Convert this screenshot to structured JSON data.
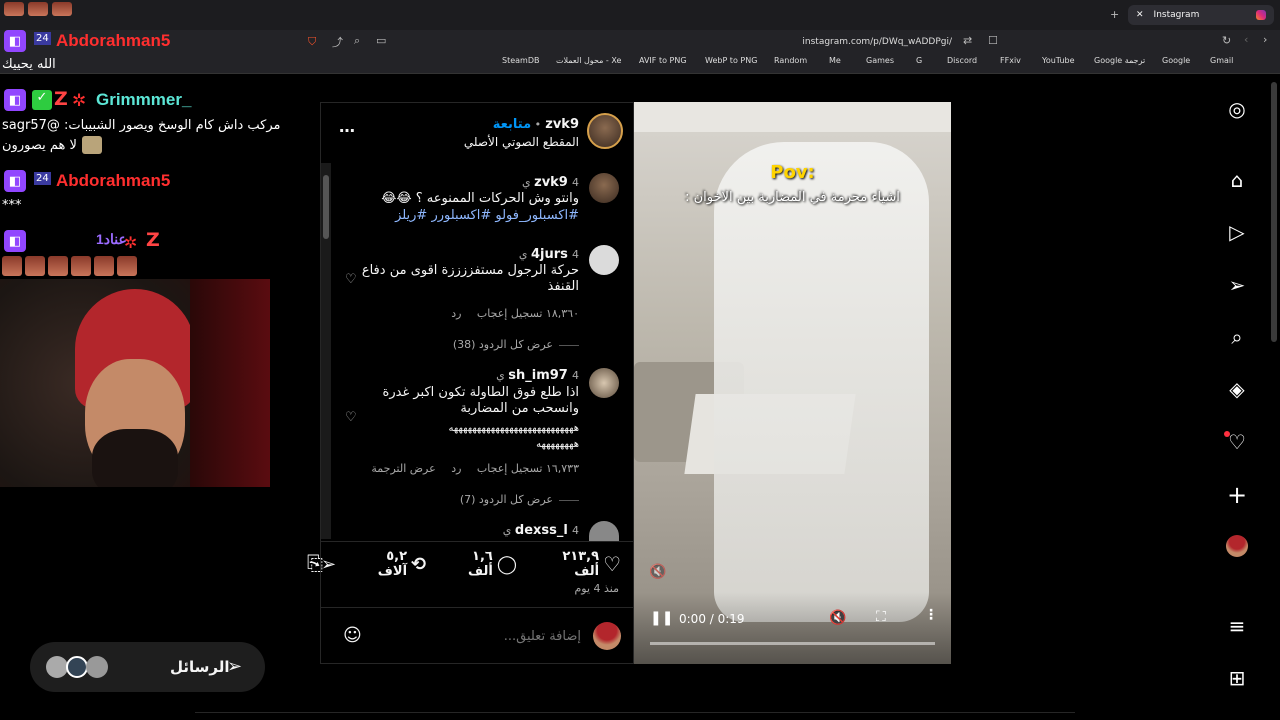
{
  "browser": {
    "tab_title": "Instagram",
    "url": "instagram.com/p/DWq_wADDPgi/",
    "bookmarks": [
      "SteamDB",
      "محول العملات - Xe",
      "AVIF to PNG",
      "WebP to PNG",
      "Random",
      "Me",
      "Games",
      "G",
      "Discord",
      "FFxiv",
      "YouTube",
      "Google ترجمة",
      "Google",
      "Gmail"
    ]
  },
  "chat": {
    "messages": [
      {
        "badge": "24",
        "user": "Abdorahman5",
        "color": "#ff2f2f",
        "text": "الله يحييك"
      },
      {
        "badge": "Z",
        "user": "Grimmmer_",
        "color": "#5ce6d6",
        "text": "مركب داش كام الوسخ ويصور الشبيبات: @sagr57",
        "text2": "لا هم يصورون"
      },
      {
        "badge": "24",
        "user": "Abdorahman5",
        "color": "#ff2f2f",
        "text": "***"
      },
      {
        "badge": "Z",
        "user": "عناد1",
        "color": "#9b6bff",
        "text": ""
      }
    ]
  },
  "post": {
    "author": "zvk9",
    "follow_label": "متابعة",
    "audio": "المقطع الصوتي الأصلي",
    "more_icon": "more-icon",
    "caption": {
      "user": "zvk9",
      "time": "4 ي",
      "text": "وانتو وش الحركات الممنوعه ؟ 😂😂",
      "hashtags": "#اكسبلور_فولو #اكسبلورر #ريلز"
    },
    "comments": [
      {
        "user": "4jurs",
        "time": "4 ي",
        "text": "حركة الرجول مستفززززة اقوى من دفاع القنفذ",
        "likes": "١٨,٣٦٠ تسجيل إعجاب",
        "reply": "رد",
        "translate": "",
        "view_replies": "عرض كل الردود (38)"
      },
      {
        "user": "sh_im97",
        "time": "4 ي",
        "text": "اذا طلع فوق الطاولة تكون اكبر غدرة وانسحب من المضاربة",
        "text2": "هههههههههههههههههههههههههههه",
        "text3": "ههههههههه",
        "likes": "١٦,٧٣٣ تسجيل إعجاب",
        "reply": "رد",
        "translate": "عرض الترجمة",
        "view_replies": "عرض كل الردود (7)"
      },
      {
        "user": "dexss_l",
        "time": "4 ي",
        "text": ""
      }
    ],
    "actions": {
      "likes": "٢١٣,٩ ألف",
      "comments": "١,٦ ألف",
      "shares": "٥,٢ آلاف"
    },
    "posted": "منذ 4 يوم",
    "comment_placeholder": "إضافة تعليق..."
  },
  "video": {
    "overlay_title": "Pov:",
    "overlay_text": "اشياء محرمة في المضاربة بين الاخوان :",
    "time": "0:00 / 0:19",
    "progress": 0
  },
  "messages_widget": {
    "label": "الرسائل"
  }
}
